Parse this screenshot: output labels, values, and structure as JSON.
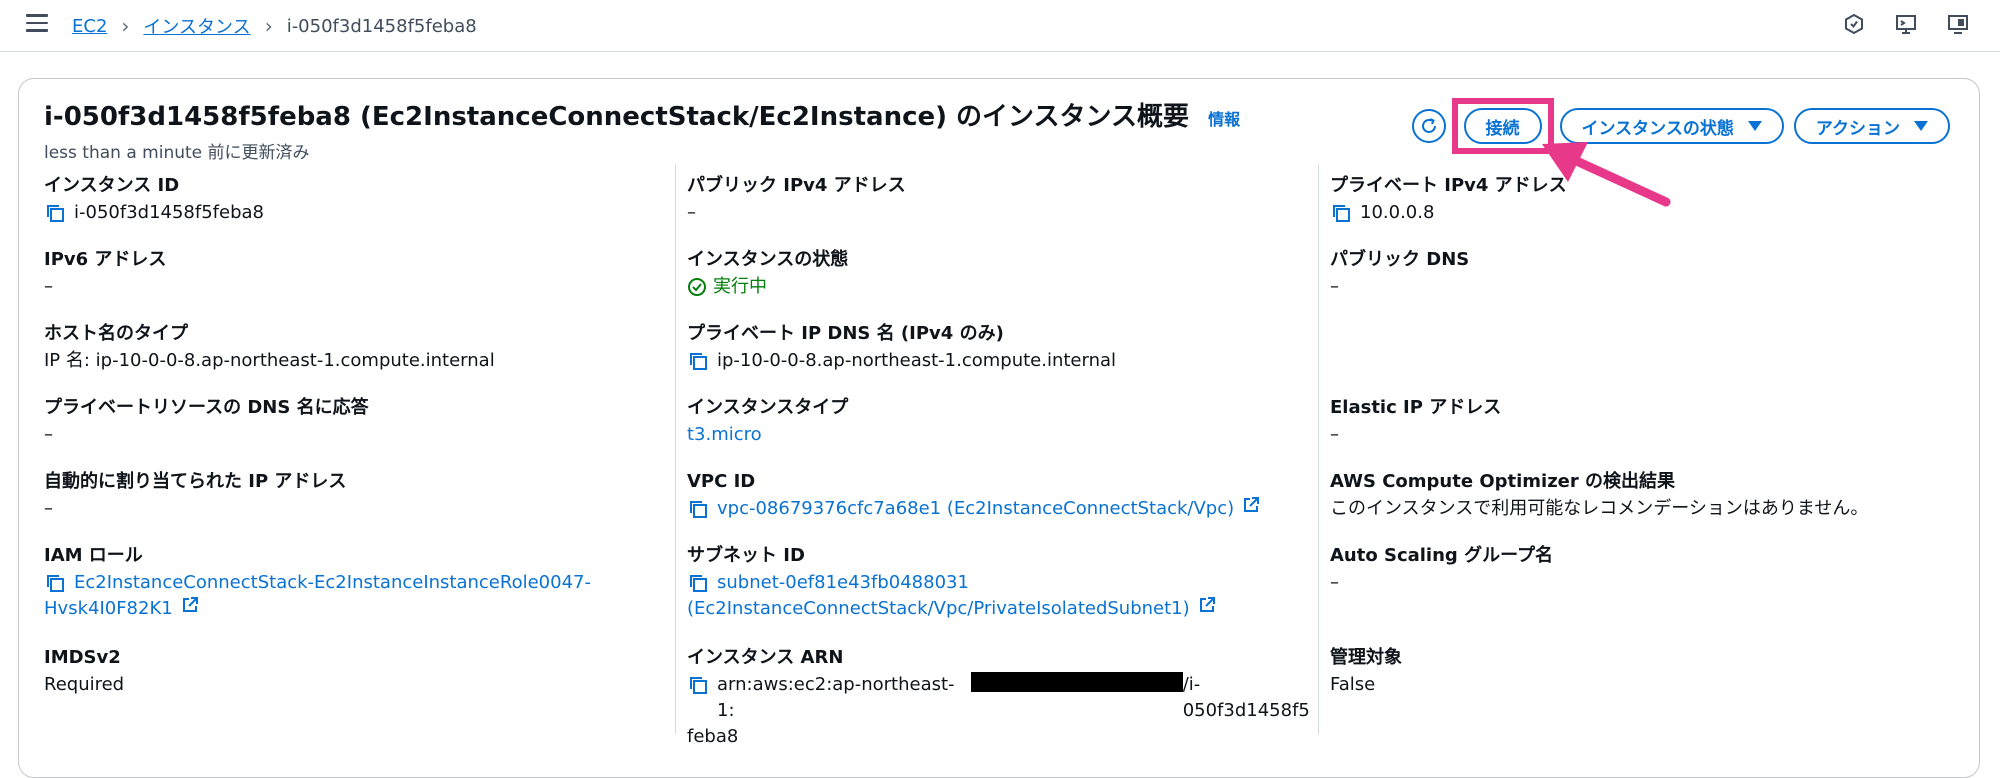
{
  "breadcrumbs": {
    "ec2": "EC2",
    "instances": "インスタンス",
    "current": "i-050f3d1458f5feba8"
  },
  "header": {
    "title": "i-050f3d1458f5feba8 (Ec2InstanceConnectStack/Ec2Instance) のインスタンス概要",
    "info": "情報",
    "updated": "less than a minute 前に更新済み",
    "connect": "接続",
    "instance_state": "インスタンスの状態",
    "actions": "アクション"
  },
  "colors": {
    "accent": "#0972d3",
    "highlight": "#e8388a",
    "running": "#037f0c"
  },
  "fields": {
    "instance_id": {
      "label": "インスタンス ID",
      "value": "i-050f3d1458f5feba8"
    },
    "ipv6": {
      "label": "IPv6 アドレス",
      "value": "–"
    },
    "hostname_type": {
      "label": "ホスト名のタイプ",
      "value": "IP 名: ip-10-0-0-8.ap-northeast-1.compute.internal"
    },
    "private_dns_resp": {
      "label": "プライベートリソースの DNS 名に応答",
      "value": "–"
    },
    "auto_ip": {
      "label": "自動的に割り当てられた IP アドレス",
      "value": "–"
    },
    "iam_role": {
      "label": "IAM ロール",
      "value_line1": "Ec2InstanceConnectStack-Ec2InstanceInstanceRole0047-",
      "value_line2": "Hvsk4I0F82K1"
    },
    "imdsv2": {
      "label": "IMDSv2",
      "value": "Required"
    },
    "public_ipv4": {
      "label": "パブリック IPv4 アドレス",
      "value": "–"
    },
    "instance_state": {
      "label": "インスタンスの状態",
      "value": "実行中"
    },
    "private_ip_dns": {
      "label": "プライベート IP DNS 名 (IPv4 のみ)",
      "value": "ip-10-0-0-8.ap-northeast-1.compute.internal"
    },
    "instance_type": {
      "label": "インスタンスタイプ",
      "value": "t3.micro"
    },
    "vpc_id": {
      "label": "VPC ID",
      "value": "vpc-08679376cfc7a68e1 (Ec2InstanceConnectStack/Vpc)"
    },
    "subnet_id": {
      "label": "サブネット ID",
      "value_line1": "subnet-0ef81e43fb0488031",
      "value_line2": "(Ec2InstanceConnectStack/Vpc/PrivateIsolatedSubnet1)"
    },
    "instance_arn": {
      "label": "インスタンス ARN",
      "value_prefix": "arn:aws:ec2:ap-northeast-1:",
      "value_suffix": "/i-050f3d1458f5",
      "value_line2": "feba8"
    },
    "private_ipv4": {
      "label": "プライベート IPv4 アドレス",
      "value": "10.0.0.8"
    },
    "public_dns": {
      "label": "パブリック DNS",
      "value": "–"
    },
    "elastic_ip": {
      "label": "Elastic IP アドレス",
      "value": "–"
    },
    "optimizer": {
      "label": "AWS Compute Optimizer の検出結果",
      "value": "このインスタンスで利用可能なレコメンデーションはありません。"
    },
    "asg": {
      "label": "Auto Scaling グループ名",
      "value": "–"
    },
    "managed": {
      "label": "管理対象",
      "value": "False"
    }
  }
}
